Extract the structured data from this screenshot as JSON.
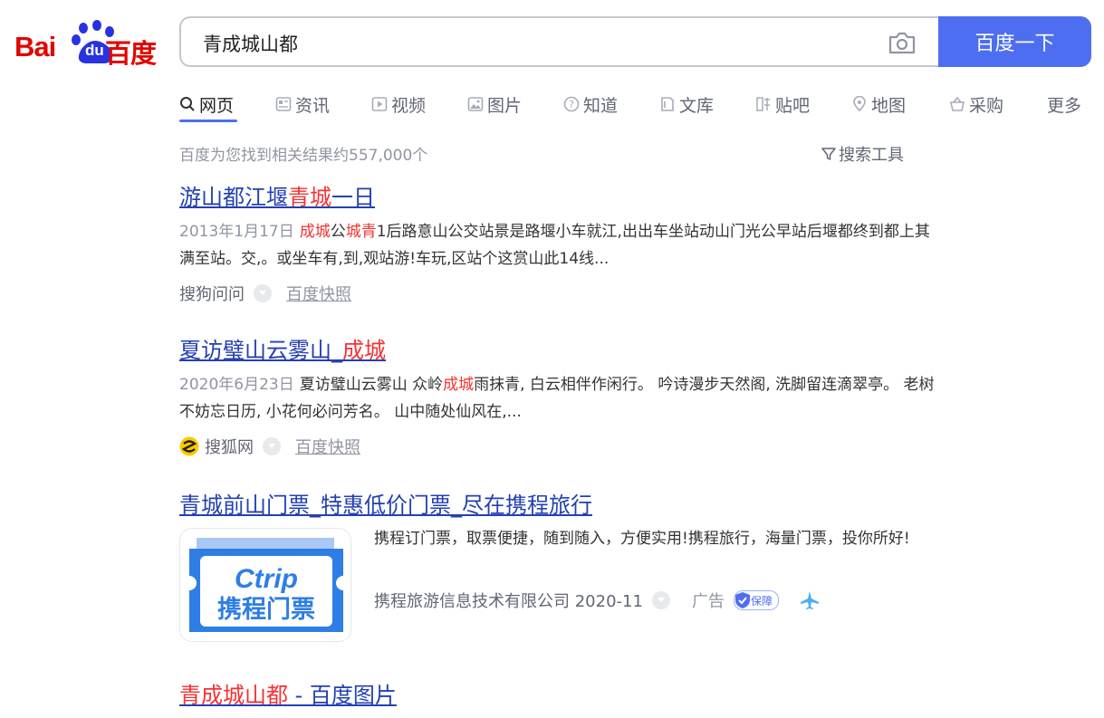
{
  "logo": {
    "part1": "Bai",
    "part2": "du",
    "part3": "百度"
  },
  "search": {
    "value": "青成城山都",
    "button_label": "百度一下"
  },
  "tabs": [
    {
      "label": "网页",
      "icon": "search-icon"
    },
    {
      "label": "资讯",
      "icon": "news-icon"
    },
    {
      "label": "视频",
      "icon": "video-icon"
    },
    {
      "label": "图片",
      "icon": "image-icon"
    },
    {
      "label": "知道",
      "icon": "question-icon"
    },
    {
      "label": "文库",
      "icon": "library-icon"
    },
    {
      "label": "贴吧",
      "icon": "tieba-icon"
    },
    {
      "label": "地图",
      "icon": "map-icon"
    },
    {
      "label": "采购",
      "icon": "basket-icon"
    },
    {
      "label": "更多",
      "icon": ""
    }
  ],
  "stats": "百度为您找到相关结果约557,000个",
  "tools_label": "搜索工具",
  "results": [
    {
      "title_a": "游山都江堰",
      "title_hl": "青城",
      "title_b": "一日",
      "date": "2013年1月17日",
      "body_hl1": "成城",
      "body_t1": "公",
      "body_hl2": "城青",
      "body_t2": "1后路意山公交站景是路堰小车就江,出出车坐站动山门光公早站后堰都终到都上其满至站。交,。或坐车有,到,观站游!车玩,区站个这赏山此14线...",
      "source": "搜狗问问",
      "snapshot": "百度快照"
    },
    {
      "title_a": "夏访璧山云雾山_",
      "title_hl": "成城",
      "date": "2020年6月23日",
      "body_t1": "夏访璧山云雾山 众岭",
      "body_hl1": "成城",
      "body_t2": "雨抹青, 白云相伴作闲行。 吟诗漫步天然阁, 洗脚留连滴翠亭。 老树不妨忘日历, 小花何必问芳名。 山中随处仙风在,...",
      "source": "搜狐网",
      "snapshot": "百度快照"
    },
    {
      "title": "青城前山门票_特惠低价门票_尽在携程旅行",
      "image_line1": "Ctrip",
      "image_line2": "携程门票",
      "body": "携程订门票，取票便捷，随到随入，方便实用!携程旅行，海量门票，投你所好!",
      "company": "携程旅游信息技术有限公司 2020-11",
      "ad_label": "广告",
      "badge": "保障"
    },
    {
      "title_hl": "青成城山都",
      "title_b": " - 百度图片"
    }
  ],
  "colors": {
    "accent": "#4e6ef2",
    "title": "#2440b3",
    "highlight": "#f73131",
    "logo_red": "#e10601",
    "logo_blue": "#2932e1"
  }
}
